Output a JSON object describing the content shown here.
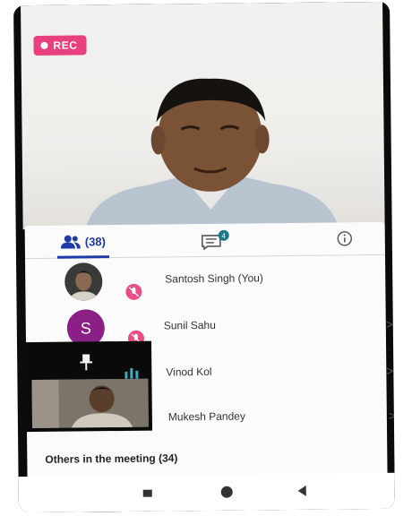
{
  "recording": {
    "label": "REC"
  },
  "tabs": {
    "participants_count": "(38)",
    "chat_badge": "4"
  },
  "participants": [
    {
      "name": "Santosh Singh (You)",
      "mic": "muted",
      "avatar": "photo"
    },
    {
      "name": "Sunil Sahu",
      "mic": "muted",
      "avatar_initial": "S",
      "avatar_color": "#8a1f87"
    },
    {
      "name": "Vinod Kol",
      "mic": "speaking"
    },
    {
      "name": "Mukesh Pandey"
    }
  ],
  "others": {
    "label": "Others in the meeting (34)"
  },
  "chevron": ">",
  "colors": {
    "accent": "#1e3aa8",
    "rec": "#e8407e",
    "mic_off": "#ea4d86",
    "audio_level": "#2fb3c9"
  },
  "icons": [
    "people-icon",
    "chat-icon",
    "info-icon",
    "mic-off-icon",
    "pin-icon",
    "audio-level-icon",
    "nav-recents-icon",
    "nav-home-icon",
    "nav-back-icon"
  ]
}
